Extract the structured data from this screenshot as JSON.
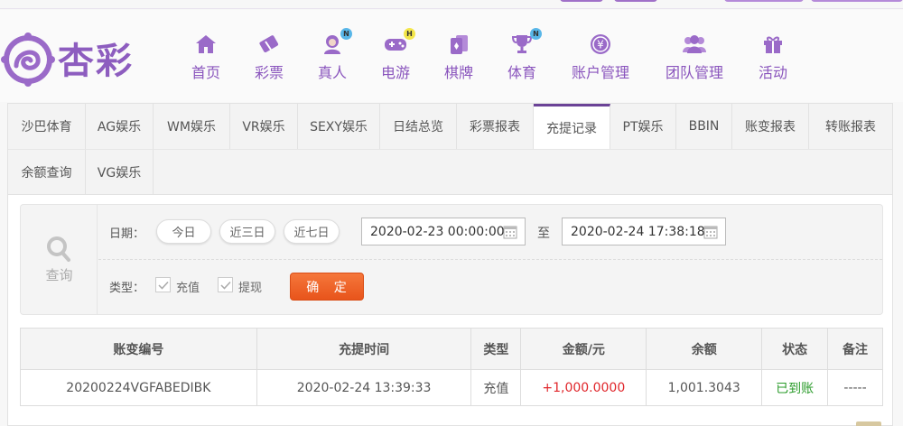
{
  "brand": {
    "logo_text": "杏彩"
  },
  "nav": {
    "items": [
      {
        "label": "首页",
        "icon": "home-icon",
        "badge": ""
      },
      {
        "label": "彩票",
        "icon": "lottery-ticket-icon",
        "badge": ""
      },
      {
        "label": "真人",
        "icon": "live-dealer-icon",
        "badge": "N"
      },
      {
        "label": "电游",
        "icon": "gamepad-icon",
        "badge": "H"
      },
      {
        "label": "棋牌",
        "icon": "cards-icon",
        "badge": ""
      },
      {
        "label": "体育",
        "icon": "trophy-icon",
        "badge": "N"
      },
      {
        "label": "账户管理",
        "icon": "yen-coin-icon",
        "badge": ""
      },
      {
        "label": "团队管理",
        "icon": "team-icon",
        "badge": ""
      },
      {
        "label": "活动",
        "icon": "gift-icon",
        "badge": ""
      }
    ]
  },
  "tabs": {
    "row1": [
      "沙巴体育",
      "AG娱乐",
      "WM娱乐",
      "VR娱乐",
      "SEXY娱乐",
      "日结总览",
      "彩票报表",
      "充提记录",
      "PT娱乐",
      "BBIN",
      "账变报表",
      "转账报表"
    ],
    "row2": [
      "余额查询",
      "VG娱乐"
    ],
    "active": "充提记录"
  },
  "filter": {
    "query_label": "查询",
    "date_label": "日期：",
    "quick_ranges": [
      "今日",
      "近三日",
      "近七日"
    ],
    "start_value": "2020-02-23 00:00:00",
    "to_label": "至",
    "end_value": "2020-02-24 17:38:18",
    "type_label": "类型：",
    "type_options": [
      "充值",
      "提现"
    ],
    "confirm_label": "确 定"
  },
  "table": {
    "columns": [
      "账变编号",
      "充提时间",
      "类型",
      "金额/元",
      "余额",
      "状态",
      "备注"
    ],
    "rows": [
      {
        "id": "20200224VGFABEDIBK",
        "time": "2020-02-24 13:39:33",
        "type": "充值",
        "amount": "+1,000.0000",
        "balance": "1,001.3043",
        "status": "已到账",
        "remark": "-----"
      }
    ]
  },
  "colors": {
    "brand_purple": "#8a55bd",
    "active_tab_border": "#6b4397",
    "confirm_orange": "#ef6328",
    "amount_red": "#e0262b",
    "status_green": "#2a9b2a"
  }
}
